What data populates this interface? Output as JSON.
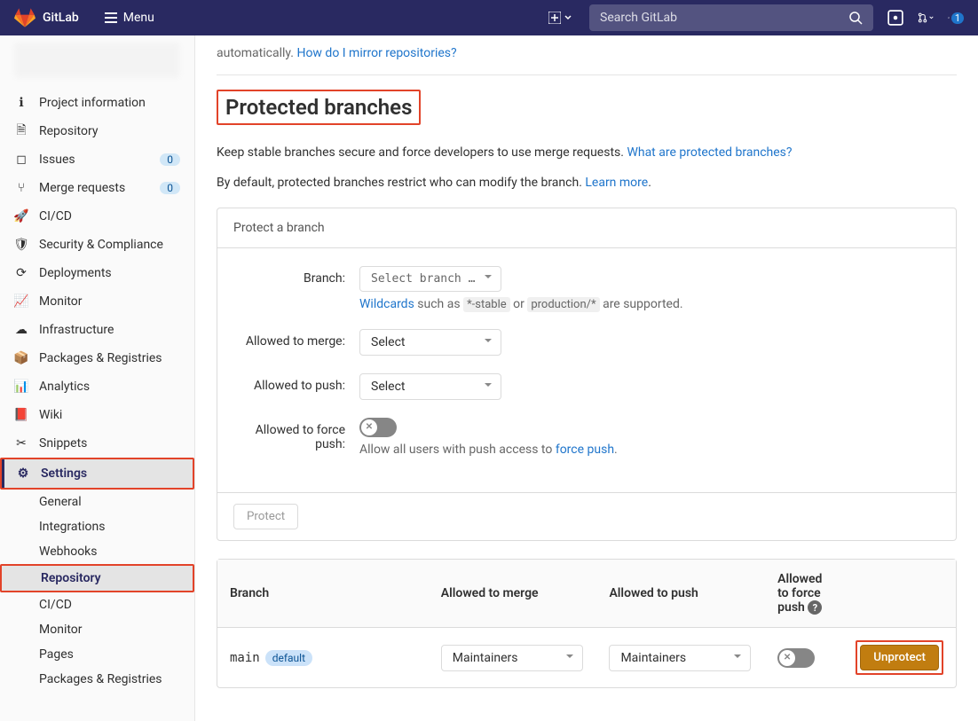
{
  "topbar": {
    "brand": "GitLab",
    "menu": "Menu",
    "search_placeholder": "Search GitLab",
    "todo_count": "1"
  },
  "sidebar": {
    "items": [
      {
        "label": "Project information"
      },
      {
        "label": "Repository"
      },
      {
        "label": "Issues",
        "count": "0"
      },
      {
        "label": "Merge requests",
        "count": "0"
      },
      {
        "label": "CI/CD"
      },
      {
        "label": "Security & Compliance"
      },
      {
        "label": "Deployments"
      },
      {
        "label": "Monitor"
      },
      {
        "label": "Infrastructure"
      },
      {
        "label": "Packages & Registries"
      },
      {
        "label": "Analytics"
      },
      {
        "label": "Wiki"
      },
      {
        "label": "Snippets"
      },
      {
        "label": "Settings"
      }
    ],
    "settings_sub": [
      {
        "label": "General"
      },
      {
        "label": "Integrations"
      },
      {
        "label": "Webhooks"
      },
      {
        "label": "Repository"
      },
      {
        "label": "CI/CD"
      },
      {
        "label": "Monitor"
      },
      {
        "label": "Pages"
      },
      {
        "label": "Packages & Registries"
      }
    ]
  },
  "main": {
    "truncated_prefix": "automatically. ",
    "truncated_link": "How do I mirror repositories?",
    "heading": "Protected branches",
    "desc1_text": "Keep stable branches secure and force developers to use merge requests. ",
    "desc1_link": "What are protected branches?",
    "desc2_text": "By default, protected branches restrict who can modify the branch. ",
    "desc2_link": "Learn more",
    "panel_title": "Protect a branch",
    "form": {
      "branch_label": "Branch:",
      "branch_placeholder": "Select branch …",
      "wildcards_link": "Wildcards",
      "wildcards_mid": " such as ",
      "wildcards_code1": "*-stable",
      "wildcards_or": " or ",
      "wildcards_code2": "production/*",
      "wildcards_end": " are supported.",
      "merge_label": "Allowed to merge:",
      "merge_value": "Select",
      "push_label": "Allowed to push:",
      "push_value": "Select",
      "force_label": "Allowed to force push:",
      "force_hint_pre": "Allow all users with push access to ",
      "force_hint_link": "force push"
    },
    "protect_btn": "Protect",
    "table": {
      "headers": {
        "branch": "Branch",
        "merge": "Allowed to merge",
        "push": "Allowed to push",
        "force": "Allowed to force push"
      },
      "row": {
        "branch": "main",
        "badge": "default",
        "merge": "Maintainers",
        "push": "Maintainers",
        "action": "Unprotect"
      }
    }
  }
}
